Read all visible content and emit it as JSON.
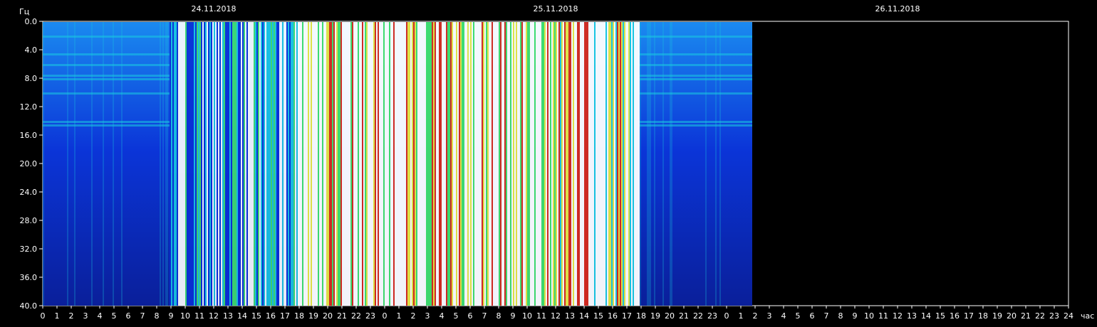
{
  "chart_data": {
    "type": "heatmap",
    "title": "",
    "ylabel": "Гц",
    "xlabel": "час",
    "ylim": [
      0,
      40
    ],
    "y_ticks": [
      "0.0",
      "4.0",
      "8.0",
      "12.0",
      "16.0",
      "20.0",
      "24.0",
      "28.0",
      "32.0",
      "36.0",
      "40.0"
    ],
    "x_ticks": [
      "0",
      "1",
      "2",
      "3",
      "4",
      "5",
      "6",
      "7",
      "8",
      "9",
      "10",
      "11",
      "12",
      "13",
      "14",
      "15",
      "16",
      "17",
      "18",
      "19",
      "20",
      "21",
      "22",
      "23",
      "0",
      "1",
      "2",
      "3",
      "4",
      "5",
      "6",
      "7",
      "8",
      "9",
      "10",
      "11",
      "12",
      "13",
      "14",
      "15",
      "16",
      "17",
      "18",
      "19",
      "20",
      "21",
      "22",
      "23",
      "0",
      "1",
      "2",
      "3",
      "4",
      "5",
      "6",
      "7",
      "8",
      "9",
      "10",
      "11",
      "12",
      "13",
      "14",
      "15",
      "16",
      "17",
      "18",
      "19",
      "20",
      "21",
      "22",
      "23",
      "24"
    ],
    "dates": [
      {
        "label": "24.11.2018",
        "start_hour": 0
      },
      {
        "label": "25.11.2018",
        "start_hour": 24
      },
      {
        "label": "26.11.2018",
        "start_hour": 48
      }
    ],
    "xlim_hours": [
      0,
      72
    ],
    "data_extent_hours": [
      0,
      49.8
    ],
    "segments": [
      {
        "from_hour": 0,
        "to_hour": 8.9,
        "level": "low"
      },
      {
        "from_hour": 8.9,
        "to_hour": 17.9,
        "level": "medium"
      },
      {
        "from_hour": 17.9,
        "to_hour": 36,
        "level": "saturated"
      },
      {
        "from_hour": 36,
        "to_hour": 41.9,
        "level": "high"
      },
      {
        "from_hour": 41.9,
        "to_hour": 49.8,
        "level": "low"
      }
    ],
    "colors": {
      "background": "#000000",
      "low": "#0a2fd6",
      "medium": "#19c8e0",
      "high": "#e8e840",
      "peak": "#d82a1a",
      "saturated": "#ffffff"
    }
  }
}
